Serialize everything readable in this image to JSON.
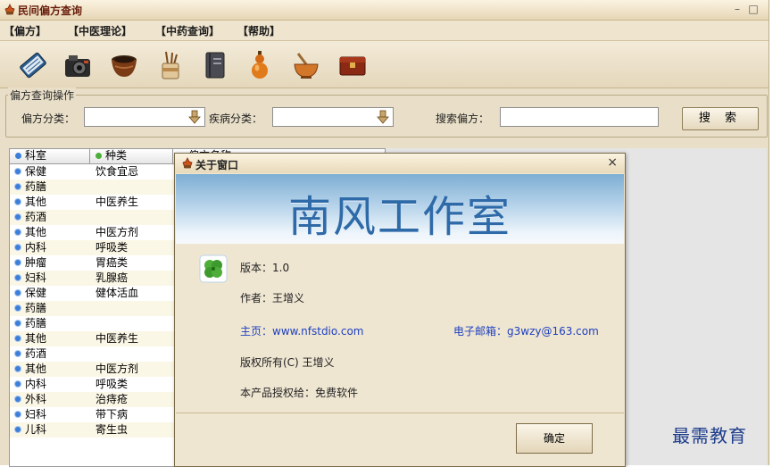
{
  "window": {
    "title": "民间偏方查询",
    "minimize": "–",
    "maximize": "□"
  },
  "menu": [
    "【偏方】",
    "【中医理论】",
    "【中药查询】",
    "【帮助】"
  ],
  "toolbar_icons": [
    "book-icon",
    "camera-icon",
    "bowl-icon",
    "brush-pot-icon",
    "notebook-icon",
    "gourd-icon",
    "mortar-icon",
    "chest-icon"
  ],
  "search": {
    "group_title": "偏方查询操作",
    "category_label": "偏方分类：",
    "category_value": "",
    "disease_label": "疾病分类：",
    "disease_value": "",
    "search_label": "搜索偏方：",
    "search_value": "",
    "button": "搜 索"
  },
  "table": {
    "columns": [
      "科室",
      "种类",
      "偏方名称"
    ],
    "rows": [
      {
        "dept": "保健",
        "kind": "饮食宜忌"
      },
      {
        "dept": "药膳",
        "kind": ""
      },
      {
        "dept": "其他",
        "kind": "中医养生"
      },
      {
        "dept": "药酒",
        "kind": ""
      },
      {
        "dept": "其他",
        "kind": "中医方剂"
      },
      {
        "dept": "内科",
        "kind": "呼吸类"
      },
      {
        "dept": "肿瘤",
        "kind": "胃癌类"
      },
      {
        "dept": "妇科",
        "kind": "乳腺癌"
      },
      {
        "dept": "保健",
        "kind": "健体活血"
      },
      {
        "dept": "药膳",
        "kind": ""
      },
      {
        "dept": "药膳",
        "kind": ""
      },
      {
        "dept": "其他",
        "kind": "中医养生"
      },
      {
        "dept": "药酒",
        "kind": ""
      },
      {
        "dept": "其他",
        "kind": "中医方剂"
      },
      {
        "dept": "内科",
        "kind": "呼吸类"
      },
      {
        "dept": "外科",
        "kind": "治痔疮"
      },
      {
        "dept": "妇科",
        "kind": "带下病"
      },
      {
        "dept": "儿科",
        "kind": "寄生虫"
      }
    ]
  },
  "about": {
    "title": "关于窗口",
    "close": "×",
    "banner": "南风工作室",
    "version": "版本：1.0",
    "author": "作者：王增义",
    "homepage": "主页：www.nfstdio.com",
    "email": "电子邮箱：g3wzy@163.com",
    "copyright": "版权所有(C) 王增义",
    "license": "本产品授权给：免费软件",
    "ok": "确定"
  },
  "watermark": "最需教育",
  "colors": {
    "accent": "#6a1f0c",
    "link": "#1d3fbf",
    "banner_text": "#2f6aa8"
  }
}
